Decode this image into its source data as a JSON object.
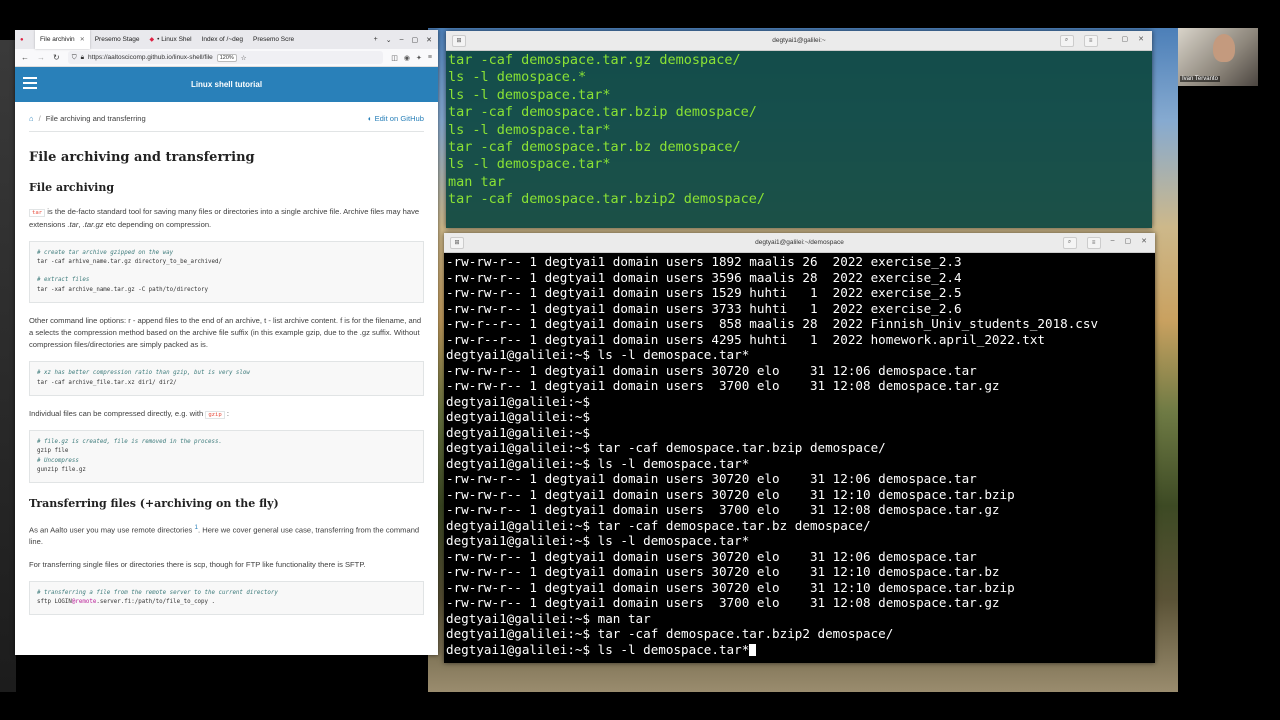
{
  "browser": {
    "tabs": [
      {
        "label": "File archivin",
        "active": true
      },
      {
        "label": "Presemo Stage",
        "active": false
      },
      {
        "label": "• Linux Shel",
        "active": false
      },
      {
        "label": "Index of /~deg",
        "active": false
      },
      {
        "label": "Presemo Scre",
        "active": false
      }
    ],
    "url": "https://aaltoscicomp.github.io/linux-shell/file",
    "zoom": "120%",
    "site_title": "Linux shell tutorial",
    "breadcrumb_current": "File archiving and transferring",
    "github_link": "Edit on GitHub",
    "page_title": "File archiving and transferring",
    "section1_title": "File archiving",
    "p1_code": "tar",
    "p1_text": "is the de-facto standard tool for saving many files or directories into a single archive file. Archive files may have extensions",
    "p1_ext1": ".tar",
    "p1_ext2": ".tar.gz",
    "p1_end": "etc depending on compression.",
    "code1": [
      {
        "type": "comment",
        "text": "# create tar archive gzipped on the way"
      },
      {
        "type": "code",
        "text": "tar -caf arhive_name.tar.gz directory_to_be_archived/"
      },
      {
        "type": "blank",
        "text": ""
      },
      {
        "type": "comment",
        "text": "# extract files"
      },
      {
        "type": "code",
        "text": "tar -xaf archive_name.tar.gz -C path/to/directory"
      }
    ],
    "p2": "Other command line options: r - append files to the end of an archive, t - list archive content. f is for the filename, and a selects the compression method based on the archive file suffix (in this example gzip, due to the .gz suffix. Without compression files/directories are simply packed as is.",
    "code2": [
      {
        "type": "comment",
        "text": "# xz has better compression ratio than gzip, but is very slow"
      },
      {
        "type": "code",
        "text": "tar -caf archive_file.tar.xz dir1/ dir2/"
      }
    ],
    "p3_text": "Individual files can be compressed directly, e.g. with",
    "p3_code": "gzip",
    "p3_end": ":",
    "code3": [
      {
        "type": "comment",
        "text": "# file.gz is created, file is removed in the process."
      },
      {
        "type": "code",
        "text": "gzip file"
      },
      {
        "type": "comment",
        "text": "# Uncompress"
      },
      {
        "type": "code",
        "text": "gunzip file.gz"
      }
    ],
    "section2_title": "Transferring files (+archiving on the fly)",
    "p4": "As an Aalto user you may use remote directories",
    "p4_sup": "1",
    "p4_end": ". Here we cover general use case, transferring from the command line.",
    "p5": "For transferring single files or directories there is scp, though for FTP like functionality there is SFTP.",
    "code4_comment": "# transferring a file from the remote server to the current directory",
    "code4_a": "sftp LOGIN",
    "code4_b": "@remote",
    "code4_c": ".server.fi:/path/to/file_to_copy ."
  },
  "terminal_top": {
    "title": "degtyai1@galilei:~",
    "lines": [
      "tar -caf demospace.tar.gz demospace/",
      "ls -l demospace.*",
      "ls -l demospace.tar*",
      "tar -caf demospace.tar.bzip demospace/",
      "ls -l demospace.tar*",
      "tar -caf demospace.tar.bz demospace/",
      "ls -l demospace.tar*",
      "man tar",
      "tar -caf demospace.tar.bzip2 demospace/"
    ]
  },
  "terminal_main": {
    "title": "degtyai1@galilei:~/demospace",
    "lines": [
      "-rw-rw-r-- 1 degtyai1 domain users 1892 maalis 26  2022 exercise_2.3",
      "-rw-rw-r-- 1 degtyai1 domain users 3596 maalis 28  2022 exercise_2.4",
      "-rw-rw-r-- 1 degtyai1 domain users 1529 huhti   1  2022 exercise_2.5",
      "-rw-rw-r-- 1 degtyai1 domain users 3733 huhti   1  2022 exercise_2.6",
      "-rw-r--r-- 1 degtyai1 domain users  858 maalis 28  2022 Finnish_Univ_students_2018.csv",
      "-rw-r--r-- 1 degtyai1 domain users 4295 huhti   1  2022 homework.april_2022.txt",
      "degtyai1@galilei:~$ ls -l demospace.tar*",
      "-rw-rw-r-- 1 degtyai1 domain users 30720 elo    31 12:06 demospace.tar",
      "-rw-rw-r-- 1 degtyai1 domain users  3700 elo    31 12:08 demospace.tar.gz",
      "degtyai1@galilei:~$",
      "degtyai1@galilei:~$",
      "degtyai1@galilei:~$",
      "degtyai1@galilei:~$ tar -caf demospace.tar.bzip demospace/",
      "degtyai1@galilei:~$ ls -l demospace.tar*",
      "-rw-rw-r-- 1 degtyai1 domain users 30720 elo    31 12:06 demospace.tar",
      "-rw-rw-r-- 1 degtyai1 domain users 30720 elo    31 12:10 demospace.tar.bzip",
      "-rw-rw-r-- 1 degtyai1 domain users  3700 elo    31 12:08 demospace.tar.gz",
      "degtyai1@galilei:~$ tar -caf demospace.tar.bz demospace/",
      "degtyai1@galilei:~$ ls -l demospace.tar*",
      "-rw-rw-r-- 1 degtyai1 domain users 30720 elo    31 12:06 demospace.tar",
      "-rw-rw-r-- 1 degtyai1 domain users 30720 elo    31 12:10 demospace.tar.bz",
      "-rw-rw-r-- 1 degtyai1 domain users 30720 elo    31 12:10 demospace.tar.bzip",
      "-rw-rw-r-- 1 degtyai1 domain users  3700 elo    31 12:08 demospace.tar.gz",
      "degtyai1@galilei:~$ man tar",
      "degtyai1@galilei:~$ tar -caf demospace.tar.bzip2 demospace/",
      "degtyai1@galilei:~$ ls -l demospace.tar*"
    ]
  },
  "webcam": {
    "name": "Ivan Tervanto"
  }
}
